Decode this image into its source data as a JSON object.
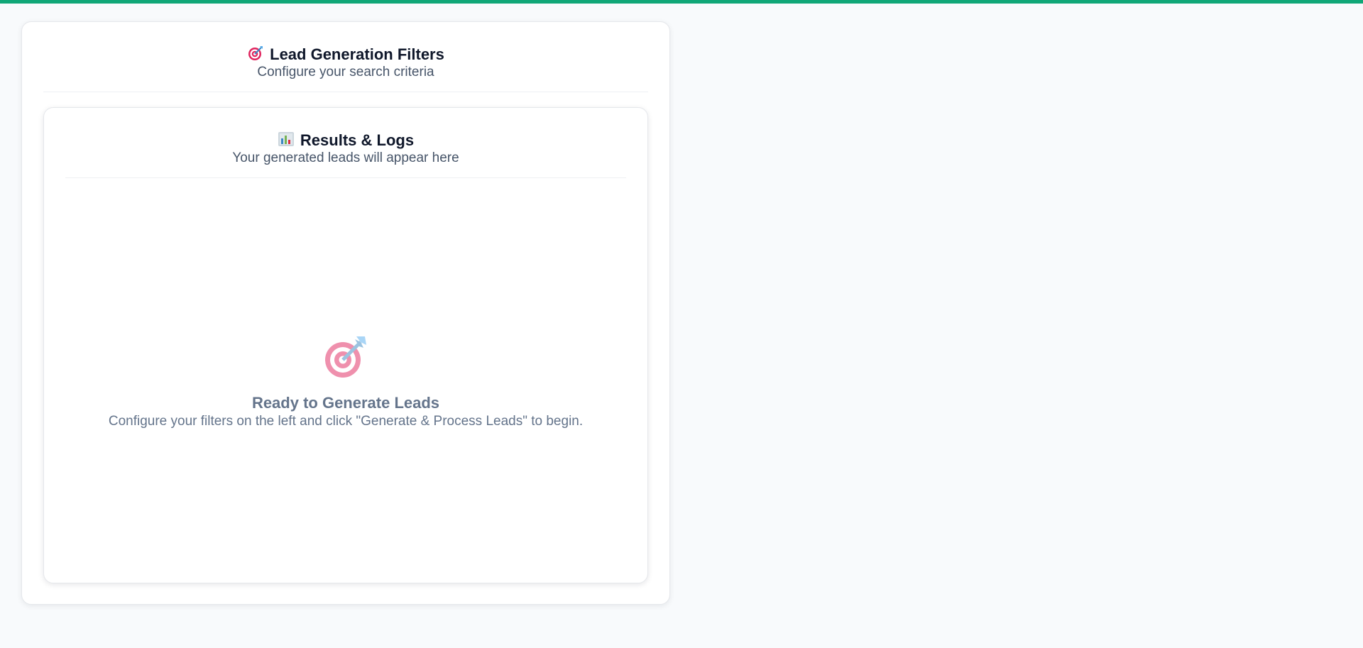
{
  "filters_panel": {
    "title": "Lead Generation Filters",
    "subtitle": "Configure your search criteria",
    "icon": "target-icon"
  },
  "results_panel": {
    "title": "Results & Logs",
    "subtitle": "Your generated leads will appear here",
    "icon": "bar-chart-icon"
  },
  "empty_state": {
    "icon": "target-icon",
    "title": "Ready to Generate Leads",
    "description": "Configure your filters on the left and click \"Generate & Process Leads\" to begin."
  },
  "colors": {
    "accent": "#10a777",
    "page_background": "#f8fafc",
    "heading": "#0f172a",
    "muted_text": "#64748b"
  }
}
